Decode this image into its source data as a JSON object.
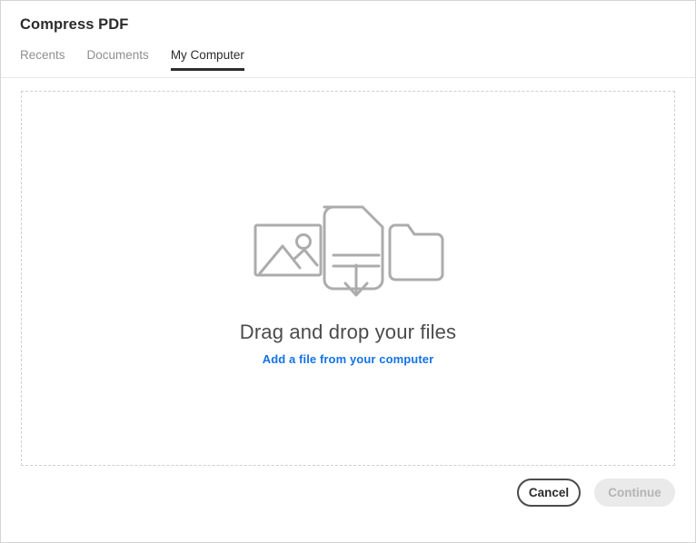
{
  "window": {
    "title": "Compress PDF"
  },
  "tabs": [
    {
      "label": "Recents",
      "active": false,
      "name": "tab-recents"
    },
    {
      "label": "Documents",
      "active": false,
      "name": "tab-documents"
    },
    {
      "label": "My Computer",
      "active": true,
      "name": "tab-my-computer"
    }
  ],
  "dropzone": {
    "heading": "Drag and drop your files",
    "link_label": "Add a file from your computer",
    "icons": [
      "image-icon",
      "document-download-icon",
      "folder-icon"
    ]
  },
  "footer": {
    "cancel_label": "Cancel",
    "continue_label": "Continue",
    "continue_disabled": true
  },
  "colors": {
    "accent_link": "#1473e6",
    "text_primary": "#2c2c2c",
    "text_muted": "#909090",
    "heading_gray": "#4b4b4b",
    "dashed_border": "#cfcfcf",
    "icon_stroke": "#acacac",
    "disabled_fill": "#eaeaea",
    "window_border": "#d4d4d4"
  }
}
